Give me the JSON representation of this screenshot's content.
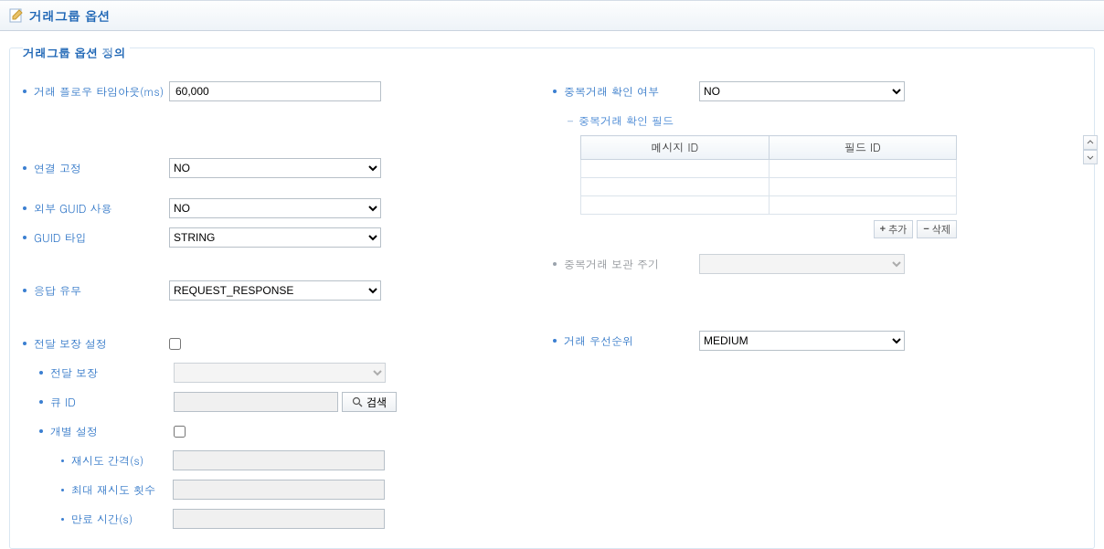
{
  "header": {
    "title": "거래그룹 옵션"
  },
  "section": {
    "title": "거래그룹 옵션 정의"
  },
  "left": {
    "flow_timeout_label": "거래 플로우 타임아웃(ms)",
    "flow_timeout_value": "60,000",
    "conn_fixed_label": "연결 고정",
    "conn_fixed_value": "NO",
    "ext_guid_label": "외부 GUID 사용",
    "ext_guid_value": "NO",
    "guid_type_label": "GUID 타입",
    "guid_type_value": "STRING",
    "resp_type_label": "응답 유무",
    "resp_type_value": "REQUEST_RESPONSE",
    "delivery_label": "전달 보장 설정",
    "delivery_sub_label": "전달 보장",
    "queue_id_label": "큐 ID",
    "search_btn": "검색",
    "individual_label": "개별 설정",
    "retry_interval_label": "재시도 간격(s)",
    "max_retry_label": "최대 재시도 횟수",
    "expire_label": "만료 시간(s)"
  },
  "right": {
    "dup_check_label": "중복거래 확인 여부",
    "dup_check_value": "NO",
    "dup_field_label": "중복거래 확인 필드",
    "tbl_msgid": "메시지 ID",
    "tbl_fieldid": "필드 ID",
    "add_btn": "추가",
    "del_btn": "삭제",
    "dup_retain_label": "중복거래 보관 주기",
    "priority_label": "거래 우선순위",
    "priority_value": "MEDIUM"
  }
}
